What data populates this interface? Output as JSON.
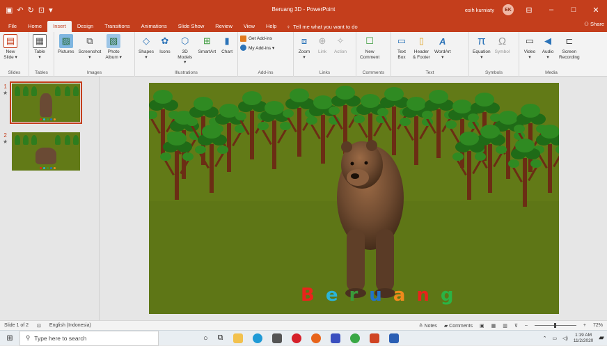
{
  "window": {
    "doc_title": "Beruang 3D - PowerPoint",
    "user_name": "esih kurniaty",
    "user_initials": "EK",
    "share_label": "Share",
    "accent": "#c43e1c"
  },
  "tabs": [
    {
      "label": "File"
    },
    {
      "label": "Home"
    },
    {
      "label": "Insert",
      "active": true
    },
    {
      "label": "Design"
    },
    {
      "label": "Transitions"
    },
    {
      "label": "Animations"
    },
    {
      "label": "Slide Show"
    },
    {
      "label": "Review"
    },
    {
      "label": "View"
    },
    {
      "label": "Help"
    }
  ],
  "tell_me": "Tell me what you want to do",
  "ribbon": {
    "slides": {
      "label": "Slides",
      "new_slide": "New\nSlide ▾"
    },
    "tables": {
      "label": "Tables",
      "table": "Table\n▾"
    },
    "images": {
      "label": "Images",
      "pictures": "Pictures",
      "screenshot": "Screenshot\n▾",
      "photo_album": "Photo\nAlbum ▾"
    },
    "illustrations": {
      "label": "Illustrations",
      "shapes": "Shapes\n▾",
      "icons": "Icons",
      "models": "3D\nModels ▾",
      "smartart": "SmartArt",
      "chart": "Chart"
    },
    "addins": {
      "label": "Add-ins",
      "get": "Get Add-ins",
      "my": "My Add-ins ▾"
    },
    "links": {
      "label": "Links",
      "zoom": "Zoom\n▾",
      "link": "Link",
      "action": "Action"
    },
    "comments": {
      "label": "Comments",
      "new_comment": "New\nComment"
    },
    "text": {
      "label": "Text",
      "text_box": "Text\nBox",
      "header_footer": "Header\n& Footer",
      "wordart": "WordArt\n▾"
    },
    "symbols": {
      "label": "Symbols",
      "equation": "Equation\n▾",
      "symbol": "Symbol"
    },
    "media": {
      "label": "Media",
      "video": "Video\n▾",
      "audio": "Audio\n▾",
      "screen_recording": "Screen\nRecording"
    }
  },
  "slides_panel": [
    {
      "num": "1",
      "star": "★"
    },
    {
      "num": "2",
      "star": "★"
    }
  ],
  "slide": {
    "word_letters": [
      {
        "ch": "B",
        "color": "#e8241b"
      },
      {
        "ch": "e",
        "color": "#2bb5d8"
      },
      {
        "ch": "r",
        "color": "#3a9a3a"
      },
      {
        "ch": "u",
        "color": "#2273c7"
      },
      {
        "ch": "a",
        "color": "#f08a1c"
      },
      {
        "ch": "n",
        "color": "#e8241b"
      },
      {
        "ch": "g",
        "color": "#2bb344"
      }
    ]
  },
  "status": {
    "slide_of": "Slide 1 of 2",
    "language": "English (Indonesia)",
    "notes": "Notes",
    "comments": "Comments",
    "zoom": "72%"
  },
  "taskbar": {
    "search_placeholder": "Type here to search",
    "time": "1:19 AM",
    "date": "11/2/2020"
  }
}
